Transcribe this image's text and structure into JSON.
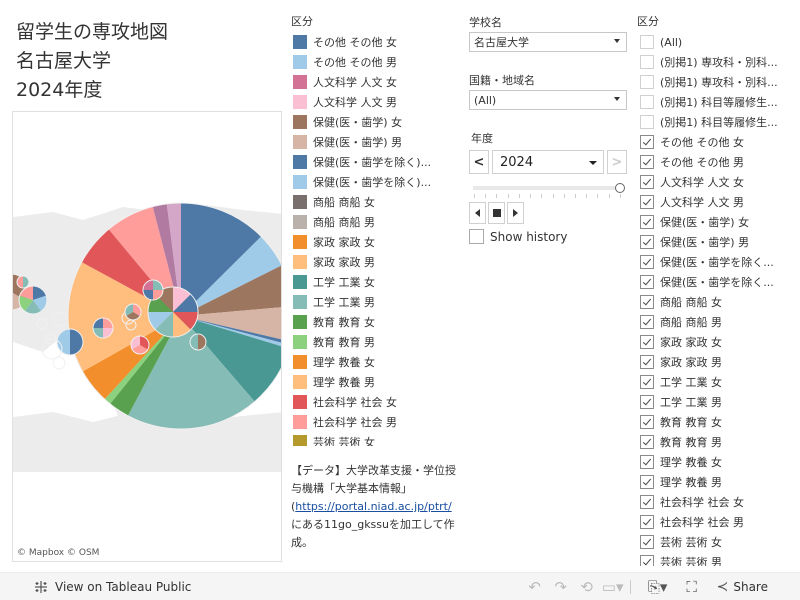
{
  "title": {
    "line1": "留学生の専攻地図",
    "line2": "名古屋大学",
    "line3": "2024年度"
  },
  "map": {
    "attribution": [
      "© Mapbox",
      "© OSM"
    ]
  },
  "legend": {
    "title": "区分",
    "items": [
      {
        "label": "その他 その他 女",
        "color": "#4e79a7"
      },
      {
        "label": "その他 その他 男",
        "color": "#a0cbe8"
      },
      {
        "label": "人文科学 人文 女",
        "color": "#d37295"
      },
      {
        "label": "人文科学 人文 男",
        "color": "#fabfd2"
      },
      {
        "label": "保健(医・歯学) 女",
        "color": "#9d7660"
      },
      {
        "label": "保健(医・歯学) 男",
        "color": "#d7b5a6"
      },
      {
        "label": "保健(医・歯学を除く)...",
        "color": "#4e79a7"
      },
      {
        "label": "保健(医・歯学を除く)...",
        "color": "#a0cbe8"
      },
      {
        "label": "商船 商船 女",
        "color": "#79706e"
      },
      {
        "label": "商船 商船 男",
        "color": "#bab0ac"
      },
      {
        "label": "家政 家政 女",
        "color": "#f28e2b"
      },
      {
        "label": "家政 家政 男",
        "color": "#ffbe7d"
      },
      {
        "label": "工学 工業 女",
        "color": "#499894"
      },
      {
        "label": "工学 工業 男",
        "color": "#86bcb6"
      },
      {
        "label": "教育 教育 女",
        "color": "#59a14f"
      },
      {
        "label": "教育 教育 男",
        "color": "#8cd17d"
      },
      {
        "label": "理学 教養 女",
        "color": "#f28e2b"
      },
      {
        "label": "理学 教養 男",
        "color": "#ffbe7d"
      },
      {
        "label": "社会科学 社会 女",
        "color": "#e15759"
      },
      {
        "label": "社会科学 社会 男",
        "color": "#ff9d9a"
      },
      {
        "label": "芸術 芸術 女",
        "color": "#b6992d"
      }
    ]
  },
  "source": {
    "line1": "【データ】大学改革支援・学位授与機構「大学基本情報」",
    "open_paren": "(",
    "link": "https://portal.niad.ac.jp/ptrt/",
    "line3": "にある11go_gkssuを加工して作成。"
  },
  "filters": {
    "school": {
      "label": "学校名",
      "value": "名古屋大学"
    },
    "country": {
      "label": "国籍・地域名",
      "value": "(All)"
    },
    "year": {
      "label": "年度",
      "value": "2024",
      "prev": "<",
      "next": ">",
      "slider_fraction": 1.0
    },
    "show_history": {
      "label": "Show history",
      "checked": false
    }
  },
  "checklist": {
    "title": "区分",
    "items": [
      {
        "label": "(All)",
        "checked": false
      },
      {
        "label": "(別掲1) 専攻科・別科...",
        "checked": false
      },
      {
        "label": "(別掲1) 専攻科・別科...",
        "checked": false
      },
      {
        "label": "(別掲1) 科目等履修生...",
        "checked": false
      },
      {
        "label": "(別掲1) 科目等履修生...",
        "checked": false
      },
      {
        "label": "その他 その他 女",
        "checked": true
      },
      {
        "label": "その他 その他 男",
        "checked": true
      },
      {
        "label": "人文科学 人文 女",
        "checked": true
      },
      {
        "label": "人文科学 人文 男",
        "checked": true
      },
      {
        "label": "保健(医・歯学) 女",
        "checked": true
      },
      {
        "label": "保健(医・歯学) 男",
        "checked": true
      },
      {
        "label": "保健(医・歯学を除く...",
        "checked": true
      },
      {
        "label": "保健(医・歯学を除く...",
        "checked": true
      },
      {
        "label": "商船 商船 女",
        "checked": true
      },
      {
        "label": "商船 商船 男",
        "checked": true
      },
      {
        "label": "家政 家政 女",
        "checked": true
      },
      {
        "label": "家政 家政 男",
        "checked": true
      },
      {
        "label": "工学 工業 女",
        "checked": true
      },
      {
        "label": "工学 工業 男",
        "checked": true
      },
      {
        "label": "教育 教育 女",
        "checked": true
      },
      {
        "label": "教育 教育 男",
        "checked": true
      },
      {
        "label": "理学 教養 女",
        "checked": true
      },
      {
        "label": "理学 教養 男",
        "checked": true
      },
      {
        "label": "社会科学 社会 女",
        "checked": true
      },
      {
        "label": "社会科学 社会 男",
        "checked": true
      },
      {
        "label": "芸術 芸術 女",
        "checked": true
      },
      {
        "label": "芸術 芸術 男",
        "checked": true
      }
    ]
  },
  "toolbar": {
    "view_on_public": "View on Tableau Public",
    "share": "Share"
  },
  "pies": {
    "main": {
      "slices": [
        {
          "name": "その他 その他 女",
          "color": "#4e79a7",
          "share": 0.125
        },
        {
          "name": "その他 その他 男",
          "color": "#a0cbe8",
          "share": 0.05
        },
        {
          "name": "保健(医・歯学) 女",
          "color": "#9d7660",
          "share": 0.06
        },
        {
          "name": "保健(医・歯学) 男",
          "color": "#d7b5a6",
          "share": 0.05
        },
        {
          "name": "保健(医・歯学を除く) 女",
          "color": "#4e79a7",
          "share": 0.005
        },
        {
          "name": "保健(医・歯学を除く) 男",
          "color": "#a0cbe8",
          "share": 0.005
        },
        {
          "name": "工学 工業 女",
          "color": "#499894",
          "share": 0.09
        },
        {
          "name": "工学 工業 男",
          "color": "#86bcb6",
          "share": 0.19
        },
        {
          "name": "教育 教育 女",
          "color": "#59a14f",
          "share": 0.03
        },
        {
          "name": "教育 教育 男",
          "color": "#8cd17d",
          "share": 0.01
        },
        {
          "name": "理学 教養 女",
          "color": "#f28e2b",
          "share": 0.05
        },
        {
          "name": "理学 教養 男",
          "color": "#ffbe7d",
          "share": 0.16
        },
        {
          "name": "社会科学 社会 女",
          "color": "#e15759",
          "share": 0.06
        },
        {
          "name": "社会科学 社会 男",
          "color": "#ff9d9a",
          "share": 0.07
        },
        {
          "name": "人文科学 人文 女",
          "color": "#b07aa1",
          "share": 0.02
        },
        {
          "name": "人文科学 人文 男",
          "color": "#d4a6c8",
          "share": 0.02
        }
      ]
    }
  }
}
